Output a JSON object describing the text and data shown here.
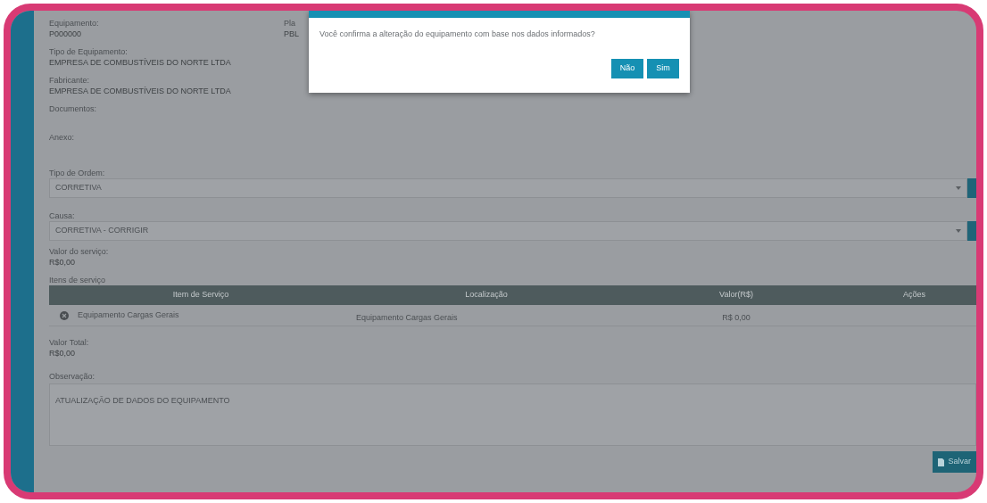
{
  "header_fields": [
    {
      "label": "Equipamento:",
      "value": "P000000"
    },
    {
      "label": "Pla",
      "value": "PBL"
    }
  ],
  "details": [
    {
      "label": "Tipo de Equipamento:",
      "value": "EMPRESA DE COMBUSTÍVEIS DO NORTE LTDA"
    },
    {
      "label": "Fabricante:",
      "value": "EMPRESA DE COMBUSTÍVEIS DO NORTE LTDA"
    }
  ],
  "documents_label": "Documentos:",
  "attachment_label": "Anexo:",
  "selects": [
    {
      "label": "Tipo de Ordem:",
      "value": "CORRETIVA"
    },
    {
      "label": "Causa:",
      "value": "CORRETIVA - CORRIGIR"
    }
  ],
  "service_value": {
    "label": "Valor do serviço:",
    "value": "R$0,00"
  },
  "items_table": {
    "title": "Itens de serviço",
    "columns": [
      "Item de Serviço",
      "Localização",
      "Valor(R$)",
      "Ações"
    ],
    "rows": [
      {
        "cells": [
          "Equipamento Cargas Gerais",
          "Equipamento Cargas Gerais",
          "R$ 0,00"
        ]
      }
    ]
  },
  "total": {
    "label": "Valor Total:",
    "value": "R$0,00"
  },
  "notes": {
    "label": "Observação:",
    "value": "ATUALIZAÇÃO DE DADOS DO EQUIPAMENTO"
  },
  "save_button": "Salvar",
  "dialog": {
    "message": "Você confirma a alteração do equipamento com base nos dados informados?",
    "buttons": [
      "Não",
      "Sim"
    ]
  }
}
